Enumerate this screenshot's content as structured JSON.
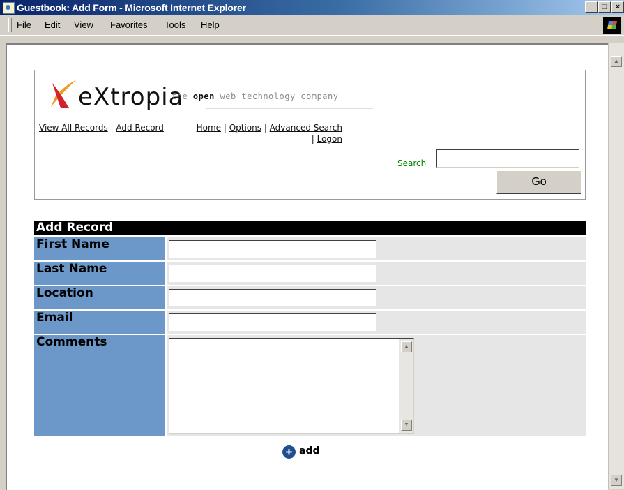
{
  "window": {
    "title": "Guestbook: Add Form - Microsoft Internet Explorer",
    "controls": {
      "minimize": "_",
      "maximize": "□",
      "close": "×"
    }
  },
  "menu": [
    "File",
    "Edit",
    "View",
    "Favorites",
    "Tools",
    "Help"
  ],
  "header": {
    "logo_text": "eXtropia",
    "tagline_pre": "the ",
    "tagline_bold": "open",
    "tagline_post": " web technology company",
    "nav_left": [
      "View All Records",
      "Add Record"
    ],
    "nav_right": [
      "Home",
      "Options",
      "Advanced Search",
      "Logon"
    ],
    "separator": " | ",
    "search_label": "Search",
    "search_value": "",
    "go_label": "Go"
  },
  "form": {
    "title": "Add Record",
    "fields": [
      {
        "label": "First Name",
        "value": ""
      },
      {
        "label": "Last Name",
        "value": ""
      },
      {
        "label": "Location",
        "value": ""
      },
      {
        "label": "Email",
        "value": ""
      },
      {
        "label": "Comments",
        "value": ""
      }
    ],
    "add_label": "add"
  },
  "colors": {
    "label_bg": "#6b97c9",
    "cell_bg": "#e6e6e6",
    "header_bg": "#000000",
    "search_label": "#008000"
  },
  "icons": [
    "ie-app-icon",
    "windows-throbber-icon",
    "add-plus-icon",
    "scroll-up-icon",
    "scroll-down-icon"
  ]
}
